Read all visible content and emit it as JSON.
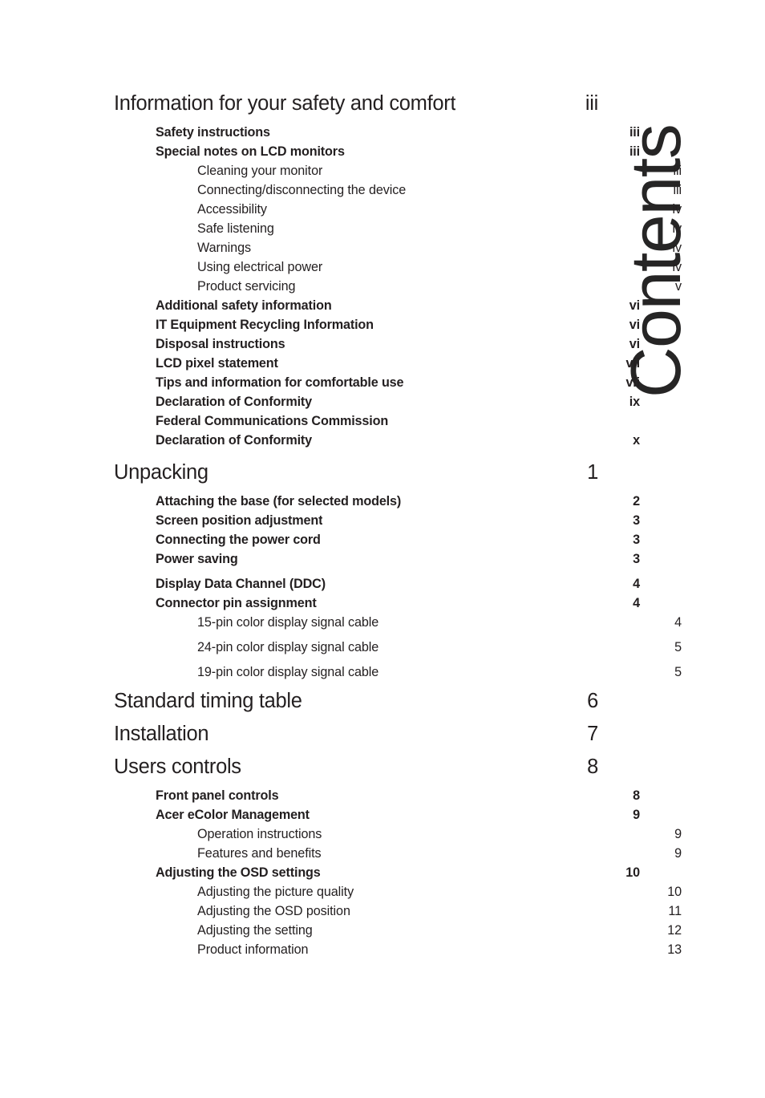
{
  "document": {
    "side_title": "Contents"
  },
  "toc": {
    "entries": [
      {
        "level": 1,
        "label": "Information for your safety and comfort",
        "page": "iii",
        "gap": ""
      },
      {
        "level": 2,
        "label": "Safety instructions",
        "page": "iii",
        "gap": "sp-top-sm"
      },
      {
        "level": 2,
        "label": "Special notes on LCD monitors",
        "page": "iii",
        "gap": ""
      },
      {
        "level": 3,
        "label": "Cleaning your monitor",
        "page": "iii",
        "gap": ""
      },
      {
        "level": 3,
        "label": "Connecting/disconnecting the device",
        "page": "iii",
        "gap": ""
      },
      {
        "level": 3,
        "label": "Accessibility",
        "page": "iv",
        "gap": ""
      },
      {
        "level": 3,
        "label": "Safe listening",
        "page": "iv",
        "gap": ""
      },
      {
        "level": 3,
        "label": "Warnings",
        "page": "iv",
        "gap": ""
      },
      {
        "level": 3,
        "label": "Using electrical power",
        "page": "iv",
        "gap": ""
      },
      {
        "level": 3,
        "label": "Product servicing",
        "page": "v",
        "gap": ""
      },
      {
        "level": 2,
        "label": "Additional safety information",
        "page": "vi",
        "gap": ""
      },
      {
        "level": 2,
        "label": "IT Equipment Recycling Information",
        "page": "vi",
        "gap": ""
      },
      {
        "level": 2,
        "label": "Disposal instructions",
        "page": "vi",
        "gap": ""
      },
      {
        "level": 2,
        "label": "LCD pixel statement",
        "page": "vii",
        "gap": ""
      },
      {
        "level": 2,
        "label": "Tips and information for comfortable use",
        "page": "vii",
        "gap": ""
      },
      {
        "level": 2,
        "label": "Declaration of Conformity",
        "page": "ix",
        "gap": ""
      },
      {
        "level": 2,
        "label": "Federal Communications Commission",
        "page": "",
        "gap": ""
      },
      {
        "level": 2,
        "label": "Declaration of Conformity",
        "page": "x",
        "gap": ""
      },
      {
        "level": 1,
        "label": "Unpacking",
        "page": "1",
        "gap": "sp-top-md"
      },
      {
        "level": 2,
        "label": "Attaching the base (for selected models)",
        "page": "2",
        "gap": "sp-top-sm"
      },
      {
        "level": 2,
        "label": "Screen position adjustment",
        "page": "3",
        "gap": ""
      },
      {
        "level": 2,
        "label": "Connecting the power cord",
        "page": "3",
        "gap": ""
      },
      {
        "level": 2,
        "label": "Power saving",
        "page": "3",
        "gap": ""
      },
      {
        "level": 2,
        "label": "Display Data Channel (DDC)",
        "page": "4",
        "gap": "sp-top-sm"
      },
      {
        "level": 2,
        "label": "Connector pin assignment",
        "page": "4",
        "gap": ""
      },
      {
        "level": 3,
        "label": "15-pin color display signal cable",
        "page": "4",
        "gap": ""
      },
      {
        "level": 3,
        "label": "24-pin color display signal cable",
        "page": "5",
        "gap": "sp-top-sm"
      },
      {
        "level": 3,
        "label": "19-pin color display signal cable",
        "page": "5",
        "gap": "sp-top-sm"
      },
      {
        "level": 1,
        "label": "Standard timing table",
        "page": "6",
        "gap": "sp-top-sm"
      },
      {
        "level": 1,
        "label": "Installation",
        "page": "7",
        "gap": "sp-top-sm"
      },
      {
        "level": 1,
        "label": "Users controls",
        "page": "8",
        "gap": "sp-top-sm"
      },
      {
        "level": 2,
        "label": "Front panel controls",
        "page": "8",
        "gap": "sp-top-sm"
      },
      {
        "level": 2,
        "label": "Acer eColor Management",
        "page": "9",
        "gap": ""
      },
      {
        "level": 3,
        "label": "Operation instructions",
        "page": "9",
        "gap": ""
      },
      {
        "level": 3,
        "label": "Features and benefits",
        "page": "9",
        "gap": ""
      },
      {
        "level": 2,
        "label": "Adjusting the OSD settings",
        "page": "10",
        "gap": ""
      },
      {
        "level": 3,
        "label": "Adjusting the picture quality",
        "page": "10",
        "gap": ""
      },
      {
        "level": 3,
        "label": "Adjusting the OSD position",
        "page": "11",
        "gap": ""
      },
      {
        "level": 3,
        "label": "Adjusting the setting",
        "page": "12",
        "gap": ""
      },
      {
        "level": 3,
        "label": "Product information",
        "page": "13",
        "gap": ""
      }
    ]
  }
}
